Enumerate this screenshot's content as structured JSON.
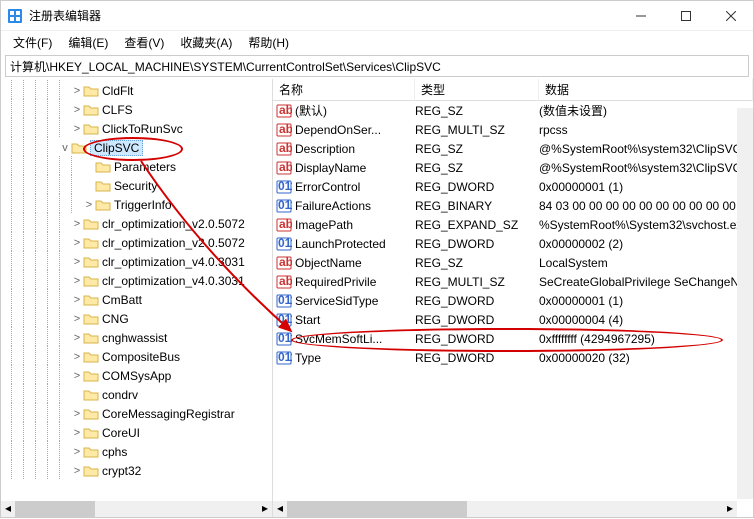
{
  "window": {
    "title": "注册表编辑器"
  },
  "menu": {
    "file": "文件(F)",
    "edit": "编辑(E)",
    "view": "查看(V)",
    "fav": "收藏夹(A)",
    "help": "帮助(H)"
  },
  "address": "计算机\\HKEY_LOCAL_MACHINE\\SYSTEM\\CurrentControlSet\\Services\\ClipSVC",
  "tree": [
    {
      "l": "CldFlt",
      "i": 5,
      "c": 1
    },
    {
      "l": "CLFS",
      "i": 5,
      "c": 1
    },
    {
      "l": "ClickToRunSvc",
      "i": 5,
      "c": 1
    },
    {
      "l": "ClipSVC",
      "i": 4,
      "c": 1,
      "open": 1,
      "sel": 1
    },
    {
      "l": "Parameters",
      "i": 6,
      "c": 0
    },
    {
      "l": "Security",
      "i": 6,
      "c": 0
    },
    {
      "l": "TriggerInfo",
      "i": 6,
      "c": 1
    },
    {
      "l": "clr_optimization_v2.0.5072",
      "i": 5,
      "c": 1
    },
    {
      "l": "clr_optimization_v2.0.5072",
      "i": 5,
      "c": 1
    },
    {
      "l": "clr_optimization_v4.0.3031",
      "i": 5,
      "c": 1
    },
    {
      "l": "clr_optimization_v4.0.3031",
      "i": 5,
      "c": 1
    },
    {
      "l": "CmBatt",
      "i": 5,
      "c": 1
    },
    {
      "l": "CNG",
      "i": 5,
      "c": 1
    },
    {
      "l": "cnghwassist",
      "i": 5,
      "c": 1
    },
    {
      "l": "CompositeBus",
      "i": 5,
      "c": 1
    },
    {
      "l": "COMSysApp",
      "i": 5,
      "c": 1
    },
    {
      "l": "condrv",
      "i": 5,
      "c": 0
    },
    {
      "l": "CoreMessagingRegistrar",
      "i": 5,
      "c": 1
    },
    {
      "l": "CoreUI",
      "i": 5,
      "c": 1
    },
    {
      "l": "cphs",
      "i": 5,
      "c": 1
    },
    {
      "l": "crypt32",
      "i": 5,
      "c": 1
    }
  ],
  "cols": {
    "name": "名称",
    "type": "类型",
    "data": "数据"
  },
  "rows": [
    {
      "n": "(默认)",
      "t": "REG_SZ",
      "d": "(数值未设置)",
      "it": "sz"
    },
    {
      "n": "DependOnSer...",
      "t": "REG_MULTI_SZ",
      "d": "rpcss",
      "it": "sz"
    },
    {
      "n": "Description",
      "t": "REG_SZ",
      "d": "@%SystemRoot%\\system32\\ClipSVC",
      "it": "sz"
    },
    {
      "n": "DisplayName",
      "t": "REG_SZ",
      "d": "@%SystemRoot%\\system32\\ClipSVC",
      "it": "sz"
    },
    {
      "n": "ErrorControl",
      "t": "REG_DWORD",
      "d": "0x00000001 (1)",
      "it": "dw"
    },
    {
      "n": "FailureActions",
      "t": "REG_BINARY",
      "d": "84 03 00 00 00 00 00 00 00 00 00 00",
      "it": "dw"
    },
    {
      "n": "ImagePath",
      "t": "REG_EXPAND_SZ",
      "d": "%SystemRoot%\\System32\\svchost.exe",
      "it": "sz"
    },
    {
      "n": "LaunchProtected",
      "t": "REG_DWORD",
      "d": "0x00000002 (2)",
      "it": "dw"
    },
    {
      "n": "ObjectName",
      "t": "REG_SZ",
      "d": "LocalSystem",
      "it": "sz"
    },
    {
      "n": "RequiredPrivile",
      "t": "REG_MULTI_SZ",
      "d": "SeCreateGlobalPrivilege SeChangeN",
      "it": "sz"
    },
    {
      "n": "ServiceSidType",
      "t": "REG_DWORD",
      "d": "0x00000001 (1)",
      "it": "dw"
    },
    {
      "n": "Start",
      "t": "REG_DWORD",
      "d": "0x00000004 (4)",
      "it": "dw"
    },
    {
      "n": "SvcMemSoftLi...",
      "t": "REG_DWORD",
      "d": "0xffffffff (4294967295)",
      "it": "dw"
    },
    {
      "n": "Type",
      "t": "REG_DWORD",
      "d": "0x00000020 (32)",
      "it": "dw"
    }
  ]
}
